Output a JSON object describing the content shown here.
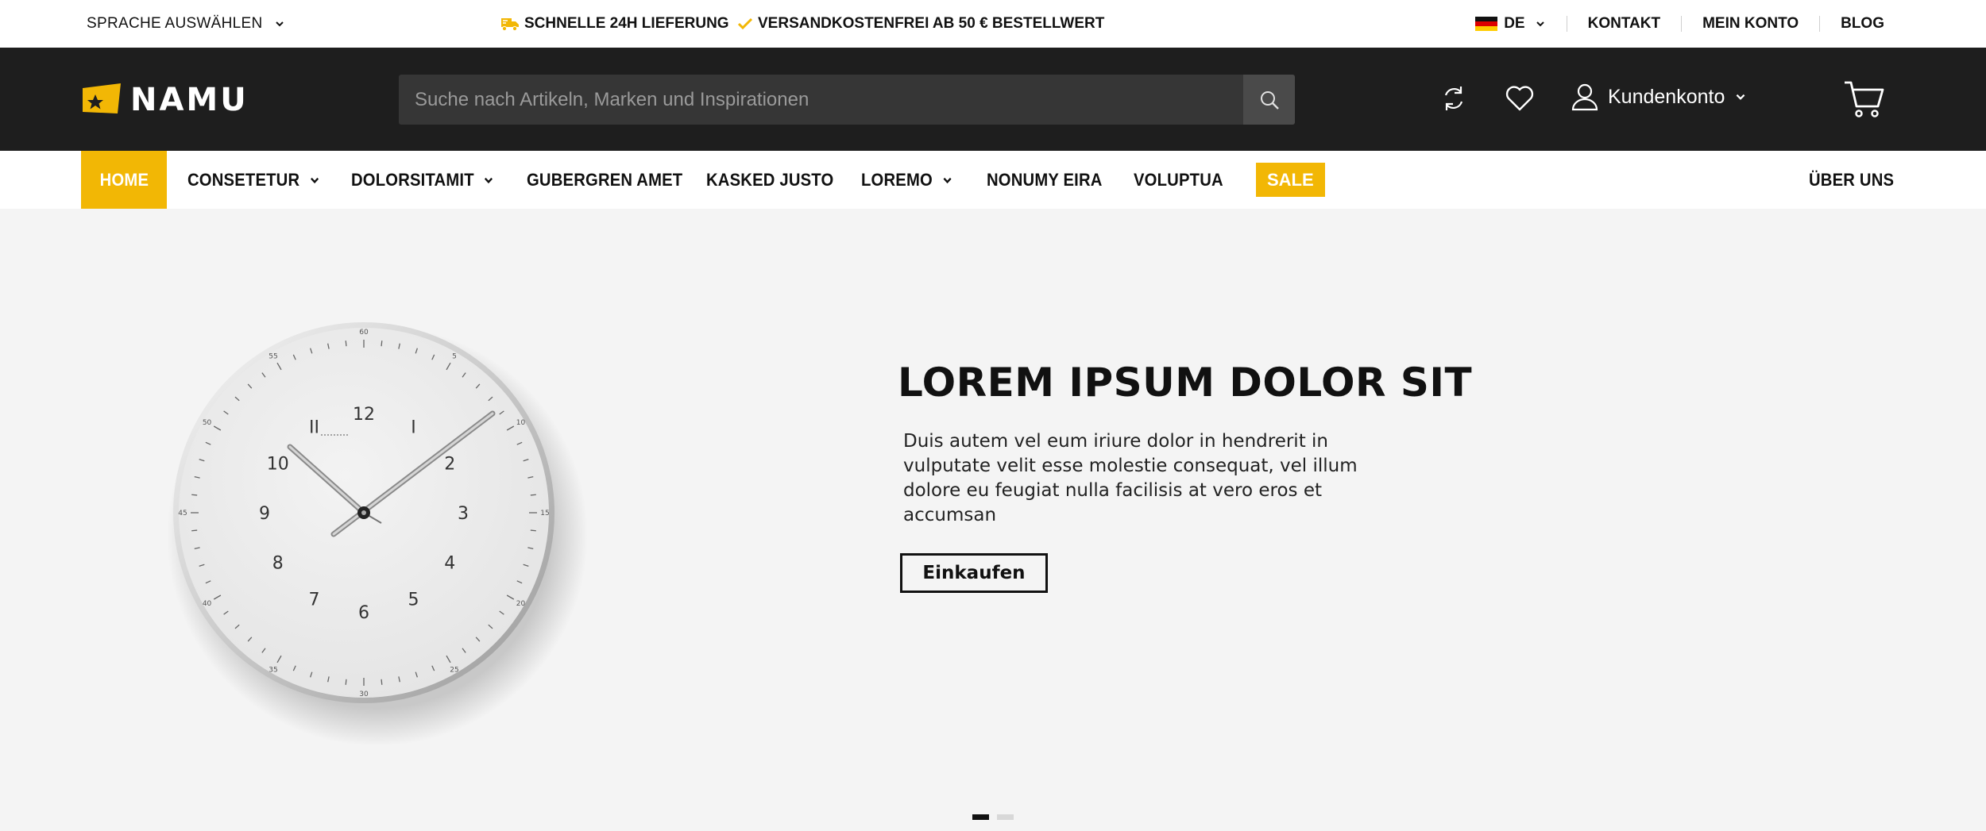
{
  "topbar": {
    "language_select": "SPRACHE AUSWÄHLEN",
    "usp_delivery": "SCHNELLE 24H LIEFERUNG",
    "usp_shipping": "VERSANDKOSTENFREI AB 50 € BESTELLWERT",
    "locale": "DE",
    "contact": "KONTAKT",
    "my_account": "MEIN KONTO",
    "blog": "BLOG"
  },
  "header": {
    "logo_text": "NAMU",
    "search_placeholder": "Suche nach Artikeln, Marken und Inspirationen",
    "account_label": "Kundenkonto"
  },
  "nav": {
    "items": [
      {
        "label": "HOME"
      },
      {
        "label": "CONSETETUR"
      },
      {
        "label": "DOLORSITAMIT"
      },
      {
        "label": "GUBERGREN AMET"
      },
      {
        "label": "KASKED JUSTO"
      },
      {
        "label": "LOREMO"
      },
      {
        "label": "NONUMY EIRA"
      },
      {
        "label": "VOLUPTUA"
      }
    ],
    "sale": "SALE",
    "about": "ÜBER UNS"
  },
  "hero": {
    "title": "LOREM IPSUM DOLOR SIT",
    "text": "Duis autem vel eum iriure dolor in hendrerit in vulputate velit esse molestie consequat, vel illum dolore eu feugiat nulla facilisis at vero eros et accumsan",
    "button": "Einkaufen",
    "slides": 2,
    "active_slide": 1
  },
  "colors": {
    "accent": "#f2b705",
    "header_bg": "#1e1e1e",
    "hero_bg": "#f4f4f4"
  },
  "icons": [
    "chevron-down-icon",
    "truck-icon",
    "check-icon",
    "flag-de-icon",
    "search-icon",
    "compare-icon",
    "heart-icon",
    "user-icon",
    "cart-icon"
  ]
}
